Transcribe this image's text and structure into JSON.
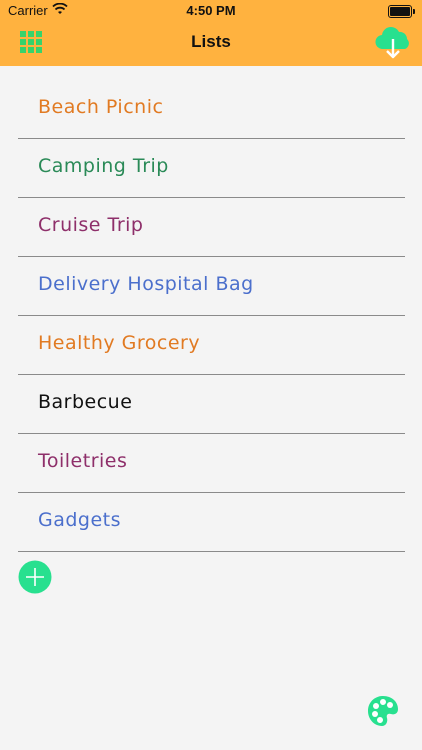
{
  "status_bar": {
    "carrier": "Carrier",
    "time": "4:50 PM"
  },
  "nav": {
    "title": "Lists",
    "left_icon": "grid-icon",
    "right_icon": "cloud-download-icon"
  },
  "lists": [
    {
      "label": "Beach Picnic",
      "color": "#e17a22"
    },
    {
      "label": "Camping Trip",
      "color": "#2a8a57"
    },
    {
      "label": "Cruise Trip",
      "color": "#8e2f6a"
    },
    {
      "label": "Delivery Hospital Bag",
      "color": "#4b6fcc"
    },
    {
      "label": "Healthy Grocery",
      "color": "#e17a22"
    },
    {
      "label": "Barbecue",
      "color": "#111111"
    },
    {
      "label": "Toiletries",
      "color": "#8e2f6a"
    },
    {
      "label": "Gadgets",
      "color": "#4b6fcc"
    }
  ],
  "actions": {
    "add_icon": "plus-circle-icon",
    "palette_icon": "palette-icon"
  },
  "colors": {
    "header_bg": "#ffb23f",
    "accent_green": "#28e08f",
    "page_bg": "#f4f4f4"
  }
}
